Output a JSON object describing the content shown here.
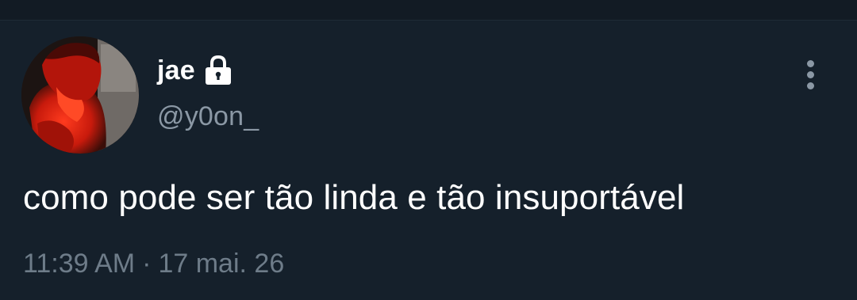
{
  "tweet": {
    "display_name": "jae",
    "handle": "@y0on_",
    "protected_icon": "lock-icon",
    "more_icon": "more-vertical-icon",
    "text": "como pode ser tão linda e tão insuportável",
    "time": "11:39 AM",
    "separator": "·",
    "date": "17 mai. 26"
  },
  "theme": {
    "background": "#15202b",
    "text_primary": "#ffffff",
    "text_secondary": "#8b98a5",
    "avatar_tint": "#e8200f"
  }
}
